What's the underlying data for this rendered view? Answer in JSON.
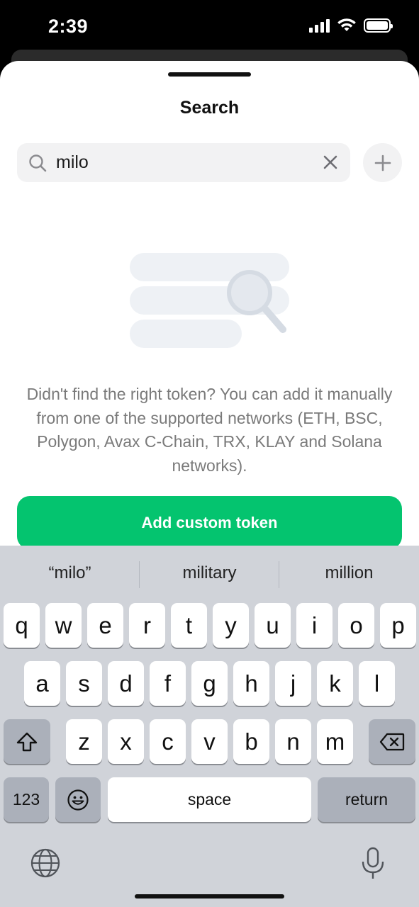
{
  "status": {
    "time": "2:39"
  },
  "header": {
    "title": "Search"
  },
  "search": {
    "value": "milo",
    "placeholder": "Search"
  },
  "empty_state": {
    "message": "Didn't find the right token? You can add it manually from one of the supported networks (ETH, BSC, Polygon, Avax C-Chain, TRX, KLAY and Solana networks)."
  },
  "actions": {
    "add_custom_token": "Add custom token"
  },
  "keyboard": {
    "suggestions": [
      "“milo”",
      "military",
      "million"
    ],
    "row1": [
      "q",
      "w",
      "e",
      "r",
      "t",
      "y",
      "u",
      "i",
      "o",
      "p"
    ],
    "row2": [
      "a",
      "s",
      "d",
      "f",
      "g",
      "h",
      "j",
      "k",
      "l"
    ],
    "row3": [
      "z",
      "x",
      "c",
      "v",
      "b",
      "n",
      "m"
    ],
    "numbers_label": "123",
    "space_label": "space",
    "return_label": "return"
  },
  "colors": {
    "accent": "#04c46f",
    "keyboard_bg": "#d0d3d9"
  }
}
